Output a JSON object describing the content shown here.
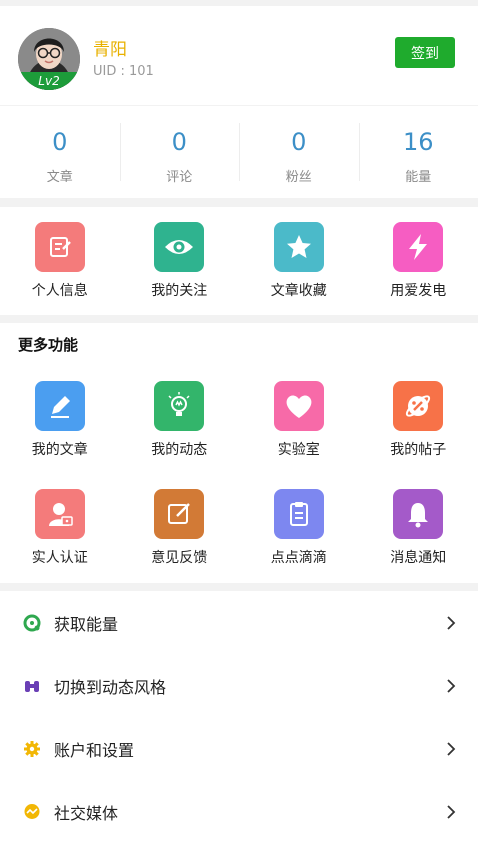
{
  "profile": {
    "username": "青阳",
    "uid": "UID : 101",
    "level": "Lv2",
    "checkin_label": "签到"
  },
  "stats": [
    {
      "value": "0",
      "label": "文章"
    },
    {
      "value": "0",
      "label": "评论"
    },
    {
      "value": "0",
      "label": "粉丝"
    },
    {
      "value": "16",
      "label": "能量"
    }
  ],
  "quick_actions": [
    {
      "label": "个人信息",
      "icon": "edit-profile-icon",
      "color": "#f47b7b"
    },
    {
      "label": "我的关注",
      "icon": "eye-icon",
      "color": "#2fb38f"
    },
    {
      "label": "文章收藏",
      "icon": "star-icon",
      "color": "#4bbac9"
    },
    {
      "label": "用爱发电",
      "icon": "lightning-icon",
      "color": "#f65dc2"
    }
  ],
  "more": {
    "title": "更多功能",
    "items": [
      {
        "label": "我的文章",
        "icon": "pencil-icon",
        "color": "#4b9ef0"
      },
      {
        "label": "我的动态",
        "icon": "bulb-icon",
        "color": "#33b56b"
      },
      {
        "label": "实验室",
        "icon": "heart-icon",
        "color": "#f76aa8"
      },
      {
        "label": "我的帖子",
        "icon": "planet-icon",
        "color": "#f77248"
      },
      {
        "label": "实人认证",
        "icon": "user-id-icon",
        "color": "#f47b7b"
      },
      {
        "label": "意见反馈",
        "icon": "feedback-icon",
        "color": "#d27a36"
      },
      {
        "label": "点点滴滴",
        "icon": "clipboard-icon",
        "color": "#7d87f0"
      },
      {
        "label": "消息通知",
        "icon": "bell-icon",
        "color": "#a45ac9"
      }
    ]
  },
  "menu": [
    {
      "label": "获取能量",
      "icon": "energy-icon",
      "color": "#2fa84f"
    },
    {
      "label": "切换到动态风格",
      "icon": "binoculars-icon",
      "color": "#6a3fb5"
    },
    {
      "label": "账户和设置",
      "icon": "gear-icon",
      "color": "#f2b705"
    },
    {
      "label": "社交媒体",
      "icon": "chat-icon",
      "color": "#f2b705"
    }
  ]
}
